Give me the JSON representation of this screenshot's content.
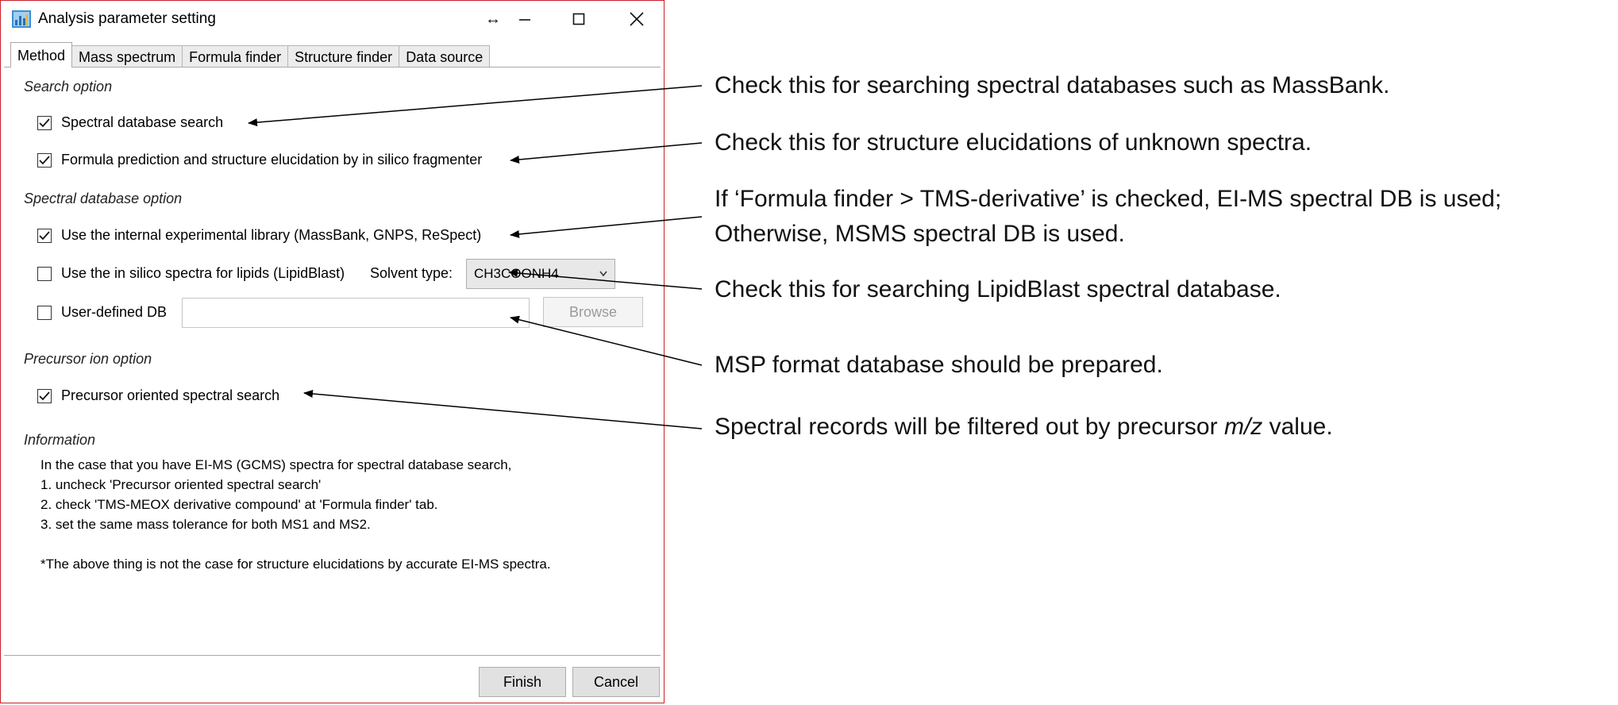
{
  "window": {
    "title": "Analysis parameter setting",
    "resize_glyph": "↔"
  },
  "tabs": [
    {
      "label": "Method",
      "active": true
    },
    {
      "label": "Mass spectrum",
      "active": false
    },
    {
      "label": "Formula finder",
      "active": false
    },
    {
      "label": "Structure finder",
      "active": false
    },
    {
      "label": "Data source",
      "active": false
    }
  ],
  "search_option": {
    "title": "Search option",
    "spectral_db_search": {
      "label": "Spectral database search",
      "checked": true
    },
    "formula_prediction": {
      "label": "Formula prediction and structure elucidation by in silico fragmenter",
      "checked": true
    }
  },
  "spectral_db_option": {
    "title": "Spectral database option",
    "internal_library": {
      "label": "Use the internal experimental library (MassBank, GNPS, ReSpect)",
      "checked": true
    },
    "lipidblast": {
      "label": "Use the in silico spectra for lipids (LipidBlast)",
      "checked": false
    },
    "solvent_type_label": "Solvent type:",
    "solvent_type_value": "CH3COONH4",
    "user_defined_db": {
      "label": "User-defined DB",
      "checked": false,
      "value": ""
    },
    "browse_label": "Browse"
  },
  "precursor_option": {
    "title": "Precursor ion option",
    "precursor_oriented": {
      "label": "Precursor oriented spectral search",
      "checked": true
    }
  },
  "information": {
    "title": "Information",
    "lines": [
      "In the case that you have EI-MS (GCMS) spectra for spectral database search,",
      "1. uncheck 'Precursor oriented spectral search'",
      "2. check 'TMS-MEOX derivative compound' at 'Formula finder' tab.",
      "3. set the same mass tolerance for both MS1 and MS2.",
      "*The above thing is not the case for structure elucidations by accurate EI-MS spectra."
    ]
  },
  "footer": {
    "finish_label": "Finish",
    "cancel_label": "Cancel"
  },
  "annotations": {
    "spectral_search": "Check this for searching spectral databases such as MassBank.",
    "structure_elucidation": "Check this for structure elucidations of unknown spectra.",
    "internal_library_line1": "If ‘Formula finder > TMS-derivative’ is checked, EI-MS spectral DB is used;",
    "internal_library_line2": "Otherwise, MSMS spectral DB is used.",
    "lipidblast": "Check this for searching LipidBlast spectral database.",
    "msp_format": "MSP format database should be prepared.",
    "precursor_prefix": "Spectral records will be filtered out by precursor ",
    "precursor_mz": "m/z",
    "precursor_suffix": " value."
  },
  "colors": {
    "window_border": "#c8202a",
    "tab_border": "#a9a9a9",
    "button_bg": "#e1e1e1"
  }
}
